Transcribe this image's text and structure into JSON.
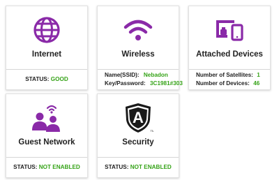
{
  "colors": {
    "accent": "#8a2aa8",
    "status_value": "#36a318",
    "title_text": "#222222"
  },
  "tiles": {
    "internet": {
      "icon": "globe-icon",
      "title": "Internet",
      "status_label": "STATUS:",
      "status_value": "GOOD"
    },
    "wireless": {
      "icon": "wifi-icon",
      "title": "Wireless",
      "ssid_label": "Name(SSID):",
      "ssid_value": "Nebadon",
      "password_label": "Key/Password:",
      "password_value": "3C1981#303"
    },
    "attached_devices": {
      "icon": "devices-icon",
      "title": "Attached Devices",
      "satellites_label": "Number of Satellites:",
      "satellites_value": "1",
      "devices_label": "Number of Devices:",
      "devices_value": "46"
    },
    "guest_network": {
      "icon": "guest-users-icon",
      "title": "Guest Network",
      "status_label": "STATUS:",
      "status_value": "NOT ENABLED"
    },
    "security": {
      "icon": "armor-shield-icon",
      "title": "Security",
      "logo_text": "A",
      "status_label": "STATUS:",
      "status_value": "NOT ENABLED"
    }
  }
}
